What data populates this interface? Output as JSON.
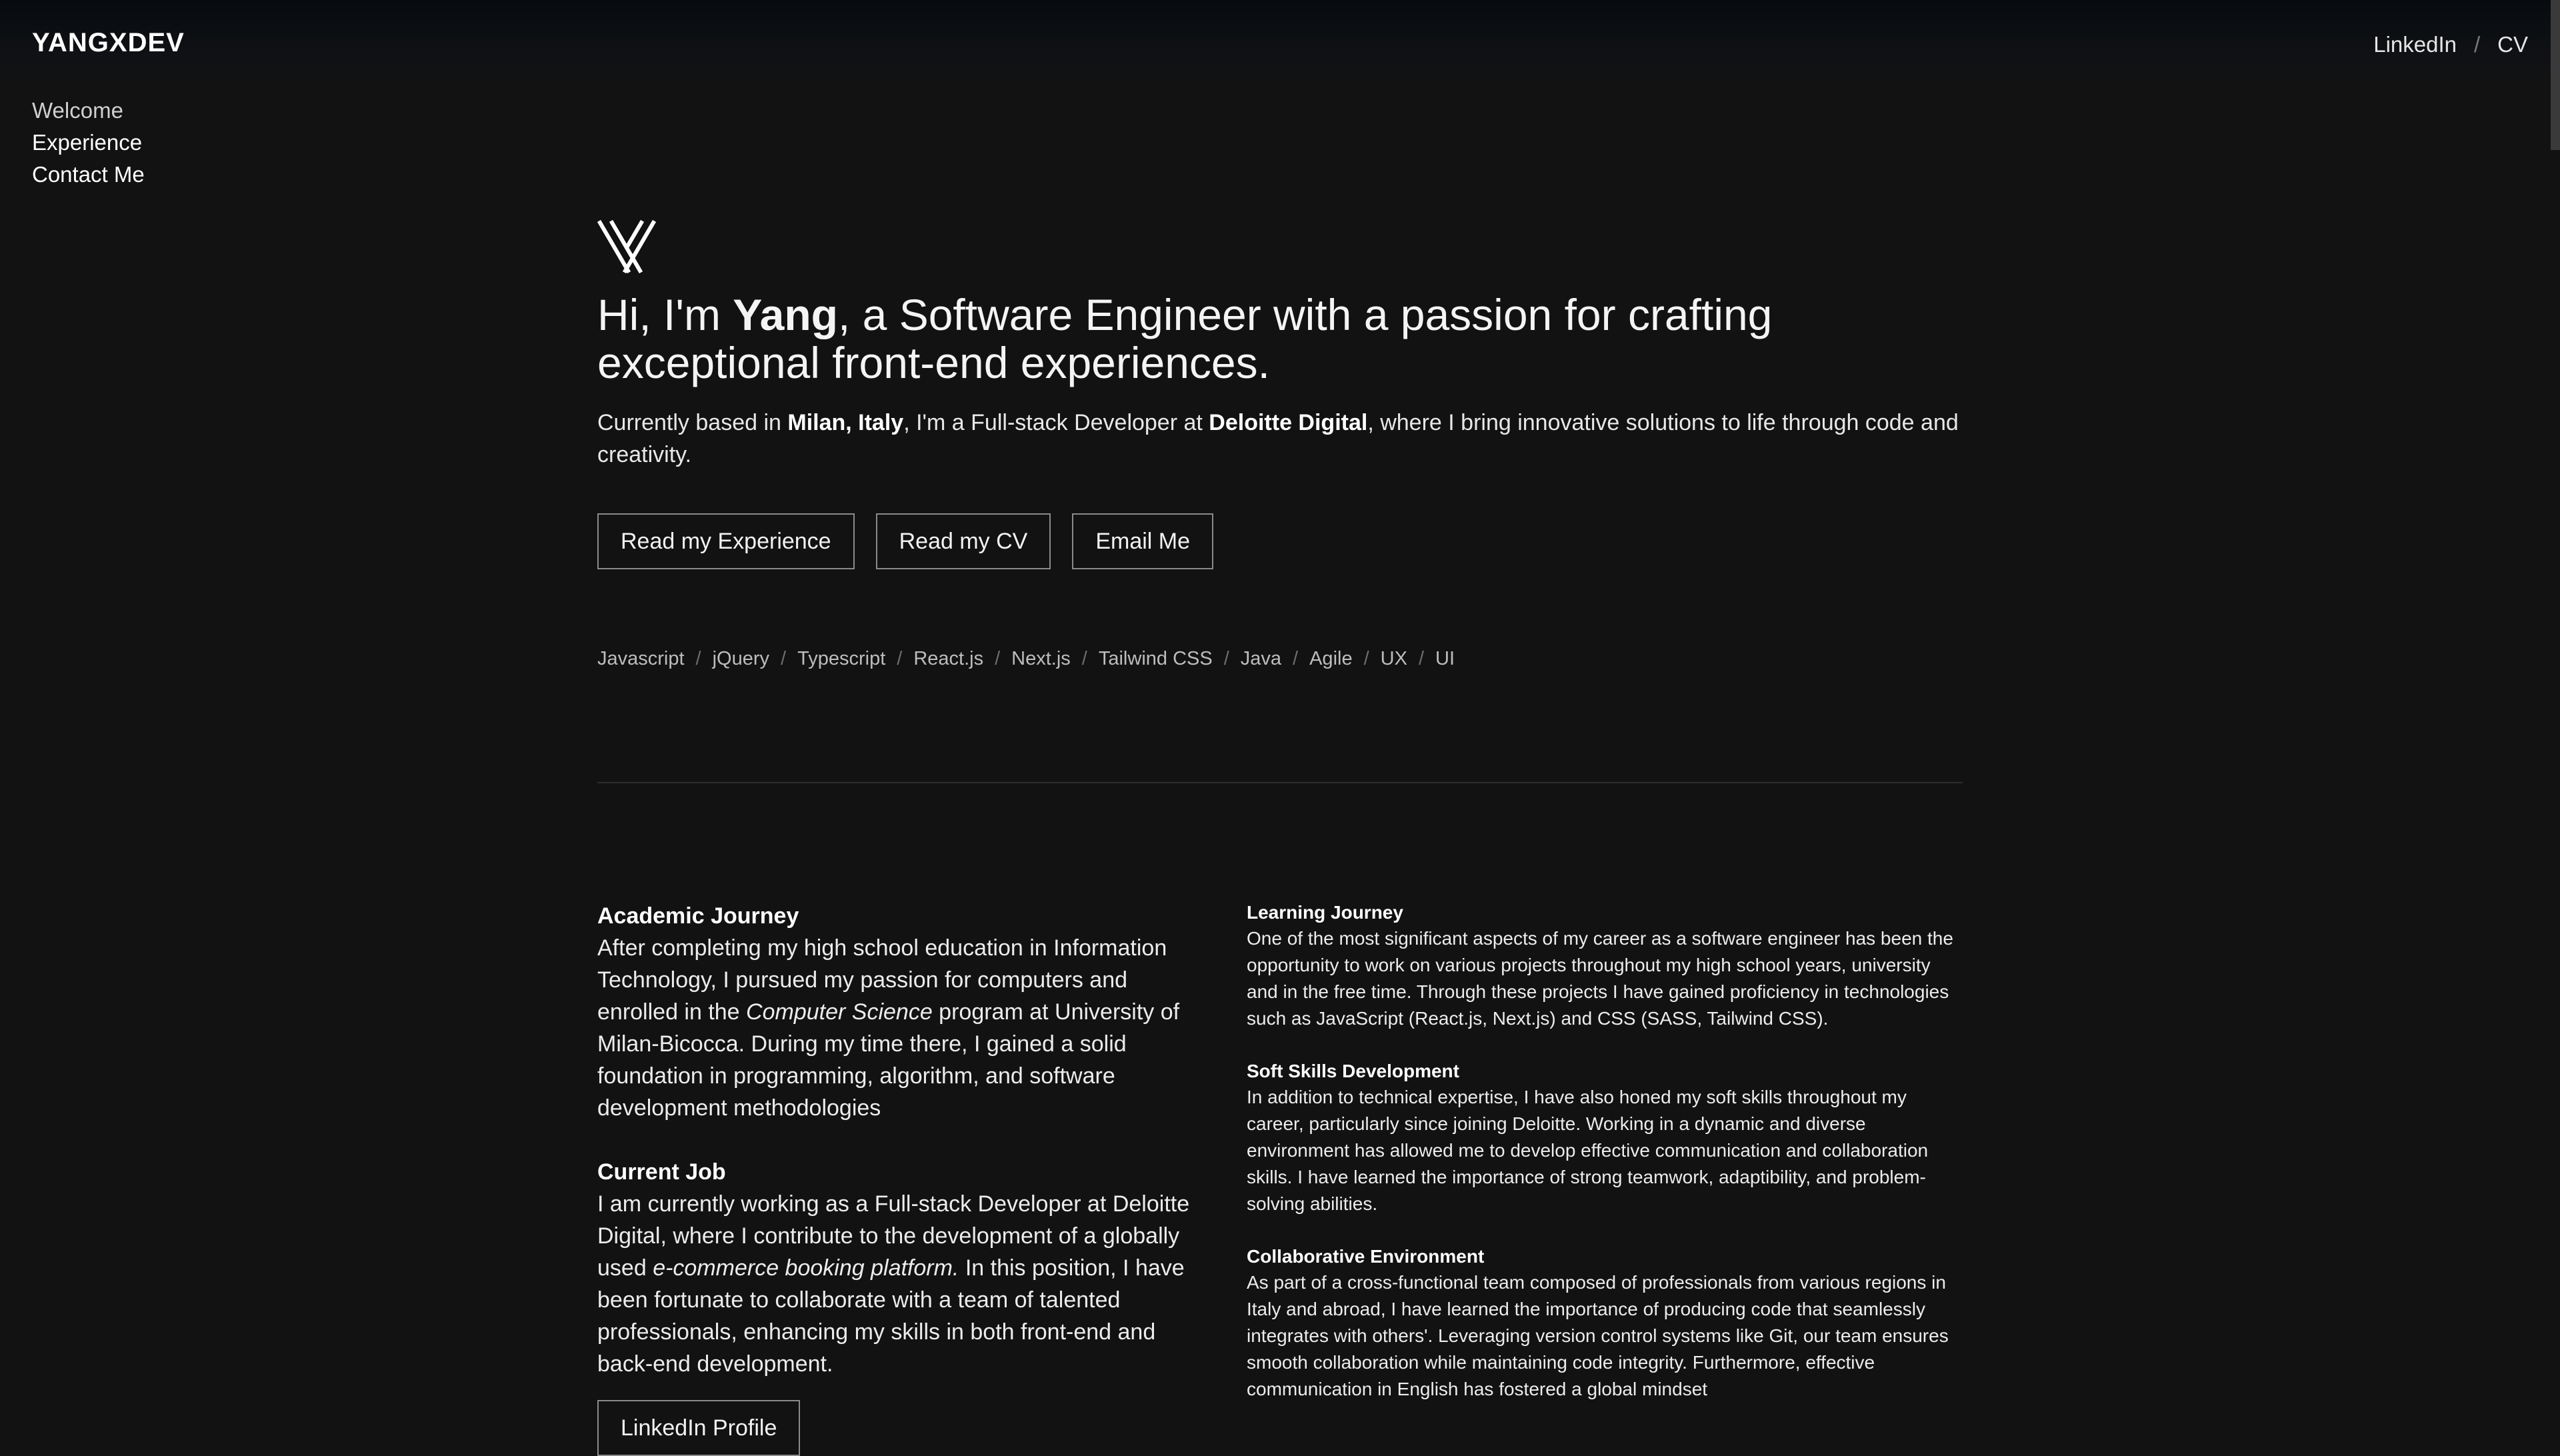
{
  "header": {
    "brand": "YANGXDEV",
    "links": [
      "LinkedIn",
      "CV"
    ],
    "separator": "/"
  },
  "sidenav": {
    "items": [
      "Welcome",
      "Experience",
      "Contact Me"
    ]
  },
  "hero": {
    "logo_icon": "yx-monogram-logo",
    "headline_pre": "Hi, I'm ",
    "headline_name": "Yang",
    "headline_post": ", a Software Engineer with a passion for crafting exceptional front-end experiences.",
    "intro_pre": "Currently based in ",
    "intro_location": "Milan, Italy",
    "intro_mid": ", I'm a Full-stack Developer at ",
    "intro_company": "Deloitte Digital",
    "intro_post": ", where I bring innovative solutions to life through code and creativity."
  },
  "actions": {
    "experience": "Read my Experience",
    "cv": "Read my CV",
    "email": "Email Me"
  },
  "skills": [
    "Javascript",
    "jQuery",
    "Typescript",
    "React.js",
    "Next.js",
    "Tailwind CSS",
    "Java",
    "Agile",
    "UX",
    "UI"
  ],
  "left": {
    "academic_title": "Academic Journey",
    "academic_pre": "After completing my high school education in Information Technology, I pursued my passion for computers and enrolled in the ",
    "academic_em": "Computer Science",
    "academic_post": " program at University of Milan-Bicocca. During my time there, I gained a solid foundation in programming, algorithm, and software development methodologies",
    "job_title": "Current Job",
    "job_pre": "I am currently working as a Full-stack Developer at Deloitte Digital, where I contribute to the development of a globally used ",
    "job_em": "e-commerce booking platform.",
    "job_post": " In this position, I have been fortunate to collaborate with a team of talented professionals, enhancing my skills in both front-end and back-end development.",
    "linkedin_button": "LinkedIn Profile"
  },
  "right": {
    "learning_title": "Learning Journey",
    "learning_text": "One of the most significant aspects of my career as a software engineer has been the opportunity to work on various projects throughout my high school years, university and in the free time. Through these projects I have gained proficiency in technologies such as JavaScript (React.js, Next.js) and CSS (SASS, Tailwind CSS).",
    "soft_title": "Soft Skills Development",
    "soft_text": "In addition to technical expertise, I have also honed my soft skills throughout my career, particularly since joining Deloitte. Working in a dynamic and diverse environment has allowed me to develop effective communication and collaboration skills. I have learned the importance of strong teamwork, adaptibility, and problem-solving abilities.",
    "collab_title": "Collaborative Environment",
    "collab_text": "As part of a cross-functional team composed of professionals from various regions in Italy and abroad, I have learned the importance of producing code that seamlessly integrates with others'. Leveraging version control systems like Git, our team ensures smooth collaboration while maintaining code integrity. Furthermore, effective communication in English has fostered a global mindset"
  }
}
